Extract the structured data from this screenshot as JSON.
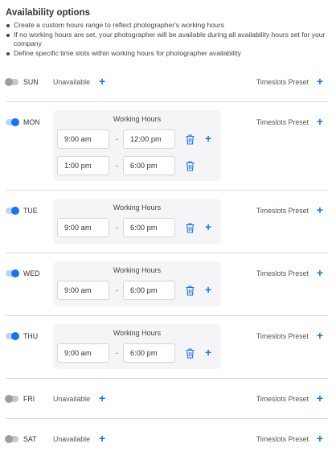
{
  "header": {
    "title": "Availability options",
    "bullets": [
      "Create a custom hours range to reflect photographer's working hours",
      "If no working hours are set, your photographer will be available during all availability hours set for your company",
      "Define specific time slots within working hours for photographer availability"
    ]
  },
  "labels": {
    "unavailable": "Unavailable",
    "timeslots_preset": "Timeslots Preset",
    "working_hours": "Working Hours",
    "dash": "-",
    "plus": "+"
  },
  "days": {
    "sun": {
      "name": "SUN",
      "enabled": false
    },
    "mon": {
      "name": "MON",
      "enabled": true,
      "ranges": [
        {
          "start": "9:00 am",
          "end": "12:00 pm"
        },
        {
          "start": "1:00 pm",
          "end": "6:00 pm"
        }
      ]
    },
    "tue": {
      "name": "TUE",
      "enabled": true,
      "ranges": [
        {
          "start": "9:00 am",
          "end": "6:00 pm"
        }
      ]
    },
    "wed": {
      "name": "WED",
      "enabled": true,
      "ranges": [
        {
          "start": "9:00 am",
          "end": "6:00 pm"
        }
      ]
    },
    "thu": {
      "name": "THU",
      "enabled": true,
      "ranges": [
        {
          "start": "9:00 am",
          "end": "6:00 pm"
        }
      ]
    },
    "fri": {
      "name": "FRI",
      "enabled": false
    },
    "sat": {
      "name": "SAT",
      "enabled": false
    }
  },
  "colors": {
    "accent": "#1a73e8",
    "toggle_off": "#9e9e9e"
  }
}
